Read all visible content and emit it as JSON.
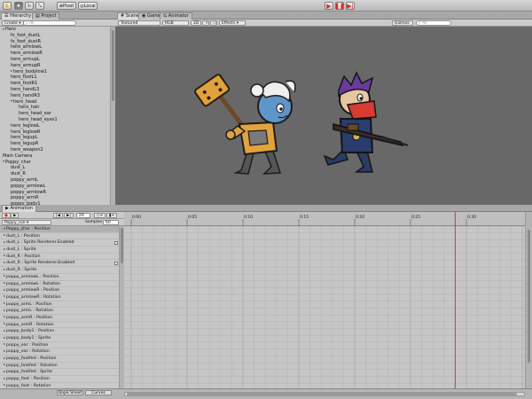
{
  "toolbar": {
    "pivot_label": "Pivot",
    "local_label": "Local",
    "layers_label": "Layers",
    "layout_label": "Layout"
  },
  "hierarchy": {
    "tab_label": "Hierarchy",
    "project_tab_label": "Project",
    "create_label": "Create",
    "search_placeholder": "All",
    "items": [
      {
        "label": "Hero",
        "depth": 0,
        "expanded": true
      },
      {
        "label": "fx_foot_dustL",
        "depth": 1
      },
      {
        "label": "fx_foot_dustR",
        "depth": 1
      },
      {
        "label": "hero_armlowL",
        "depth": 1
      },
      {
        "label": "hero_armlowR",
        "depth": 1
      },
      {
        "label": "hero_armupL",
        "depth": 1
      },
      {
        "label": "hero_armupR",
        "depth": 1
      },
      {
        "label": "hero_bodylow1",
        "depth": 1,
        "collapsed": true
      },
      {
        "label": "hero_footL1",
        "depth": 1
      },
      {
        "label": "hero_footR1",
        "depth": 1
      },
      {
        "label": "hero_handL3",
        "depth": 1
      },
      {
        "label": "hero_handR3",
        "depth": 1
      },
      {
        "label": "hero_head",
        "depth": 1,
        "expanded": true
      },
      {
        "label": "hero_hair",
        "depth": 2
      },
      {
        "label": "hero_head_ear",
        "depth": 2
      },
      {
        "label": "hero_head_eyes1",
        "depth": 2
      },
      {
        "label": "hero_leglowL",
        "depth": 1
      },
      {
        "label": "hero_leglowR",
        "depth": 1
      },
      {
        "label": "hero_legupL",
        "depth": 1
      },
      {
        "label": "hero_legupR",
        "depth": 1
      },
      {
        "label": "hero_weapon2",
        "depth": 1
      },
      {
        "label": "Main Camera",
        "depth": 0
      },
      {
        "label": "Poppy_char",
        "depth": 0,
        "expanded": true
      },
      {
        "label": "dust_L",
        "depth": 1
      },
      {
        "label": "dust_R",
        "depth": 1
      },
      {
        "label": "poppy_armL",
        "depth": 1
      },
      {
        "label": "poppy_armlowL",
        "depth": 1
      },
      {
        "label": "poppy_armlowR",
        "depth": 1
      },
      {
        "label": "poppy_armR",
        "depth": 1
      },
      {
        "label": "poppy_body1",
        "depth": 1
      },
      {
        "label": "poppy_ear",
        "depth": 1
      }
    ]
  },
  "scene": {
    "tabs": [
      "Scene",
      "Game",
      "Animator"
    ],
    "shading_label": "Textured",
    "render_label": "RGB",
    "mode_2d_label": "2D",
    "effects_label": "Effects",
    "gizmos_label": "Gizmos",
    "search_placeholder": "All",
    "background_color": "#686868"
  },
  "animation": {
    "tab_label": "Animation",
    "frame_value": "29",
    "clip_label": "Poppy_run",
    "samples_label": "Samples",
    "samples_value": "60",
    "ruler_labels": [
      "0:00",
      "0:05",
      "0:10",
      "0:15",
      "0:20",
      "0:25",
      "0:30"
    ],
    "playhead_frame": 29,
    "header_row": "Poppy_char : Position",
    "properties": [
      "dust_L : Position",
      "dust_L : Sprite Renderer.Enabled",
      "dust_L : Sprite",
      "dust_R : Position",
      "dust_R : Sprite Renderer.Enabled",
      "dust_R : Sprite",
      "poppy_armlowL : Position",
      "poppy_armlowL : Rotation",
      "poppy_armlowR : Position",
      "poppy_armlowR : Rotation",
      "poppy_armL : Position",
      "poppy_armL : Rotation",
      "poppy_armR : Position",
      "poppy_armR : Rotation",
      "poppy_body1 : Position",
      "poppy_body1 : Sprite",
      "poppy_ear : Position",
      "poppy_ear : Rotation",
      "poppy_footfed : Position",
      "poppy_footfed : Rotation",
      "poppy_footfed : Sprite",
      "poppy_foot : Position",
      "poppy_foot : Rotation",
      "poppy_hairL : Position",
      "poppy_hairL : Rotation",
      "poppy_hairR : Position",
      "poppy_hairR : Rotation"
    ],
    "dopesheet_label": "Dope Sheet",
    "curves_label": "Curves",
    "playhead_color": "#d23a3a"
  }
}
